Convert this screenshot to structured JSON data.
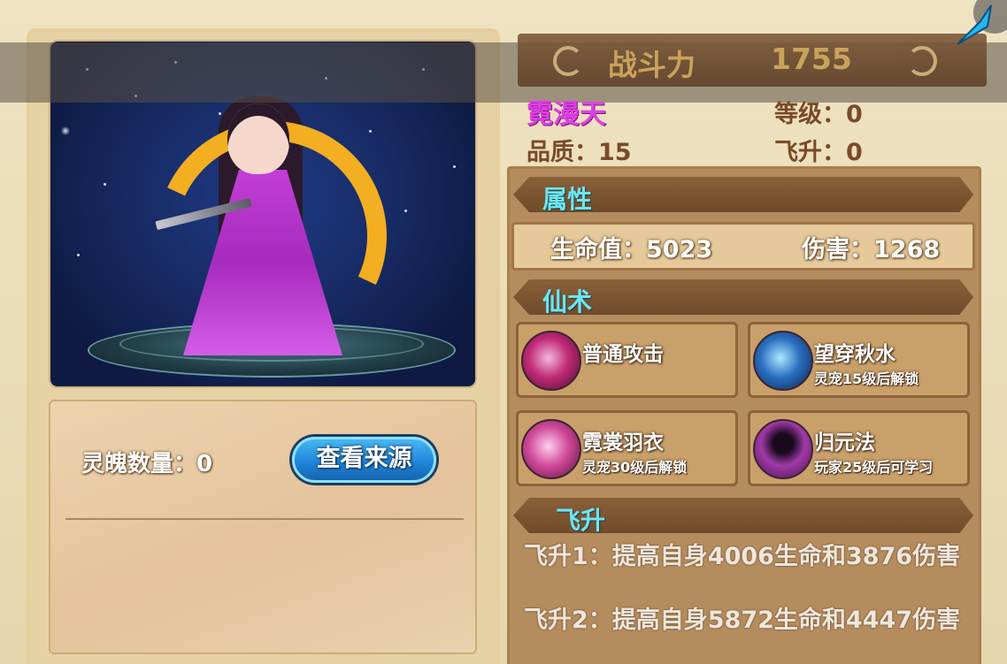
{
  "combat_power": {
    "label": "战斗力",
    "value": "1755"
  },
  "character": {
    "name": "霓漫天",
    "level_label": "等级：0",
    "quality_label": "品质：15",
    "ascend_label": "飞升：0"
  },
  "souls": {
    "count_label": "灵魄数量：0",
    "source_button": "查看来源"
  },
  "sections": {
    "attributes": "属性",
    "skills": "仙术",
    "ascend": "飞升"
  },
  "attributes": {
    "hp": "生命值：5023",
    "damage": "伤害：1268"
  },
  "skills": [
    {
      "name": "普通攻击",
      "note": "",
      "icon": "phoenix-swirl-icon",
      "color": "#c02a78"
    },
    {
      "name": "望穿秋水",
      "note": "灵宠15级后解锁",
      "icon": "water-wave-icon",
      "color": "#2a6fc0"
    },
    {
      "name": "霓裳羽衣",
      "note": "灵宠30级后解锁",
      "icon": "pink-swirl-icon",
      "color": "#d04a9a"
    },
    {
      "name": "归元法",
      "note": "玩家25级后可学习",
      "icon": "shadow-figure-icon",
      "color": "#a03aa8"
    }
  ],
  "ascend_effects": [
    "飞升1：提高自身4006生命和3876伤害",
    "飞升2：提高自身5872生命和4447伤害"
  ],
  "colors": {
    "name": "#e23ee8",
    "section_title": "#6de6f2",
    "button": "#1f86d9",
    "panel": "#b58c5e"
  }
}
